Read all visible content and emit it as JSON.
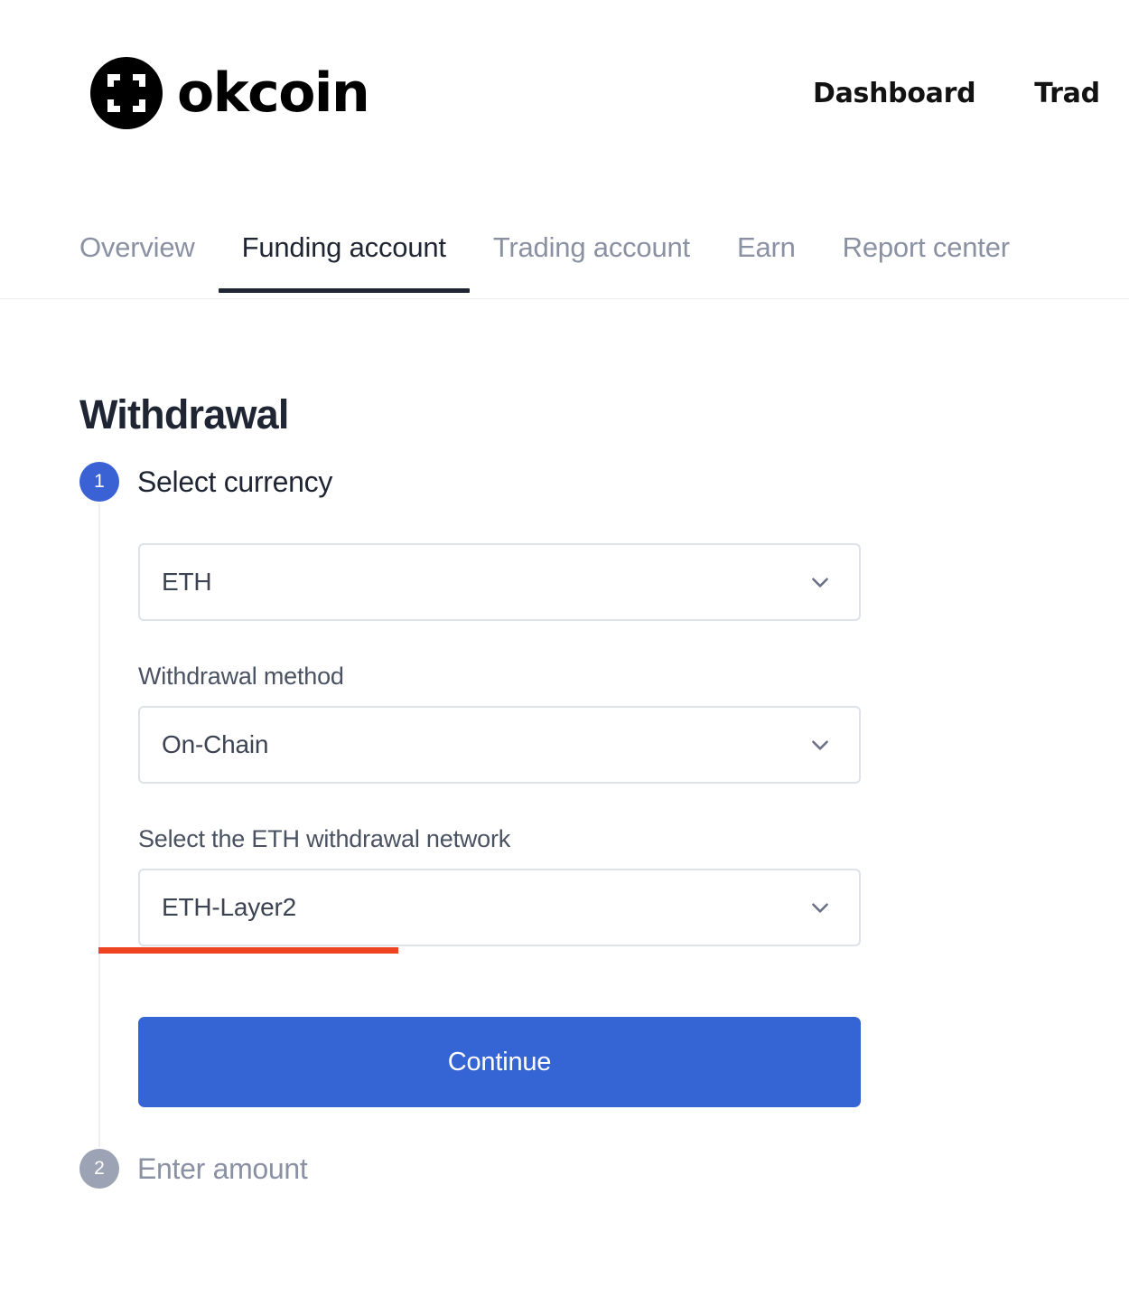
{
  "header": {
    "brand_name": "okcoin",
    "brand_mark_icon": "okcoin-logo-icon",
    "nav": [
      {
        "label": "Dashboard"
      },
      {
        "label": "Trad"
      }
    ]
  },
  "tabs": [
    {
      "label": "Overview",
      "active": false
    },
    {
      "label": "Funding account",
      "active": true
    },
    {
      "label": "Trading account",
      "active": false
    },
    {
      "label": "Earn",
      "active": false
    },
    {
      "label": "Report center",
      "active": false
    }
  ],
  "page": {
    "title": "Withdrawal"
  },
  "steps": [
    {
      "number": "1",
      "title": "Select currency",
      "active": true,
      "fields": {
        "currency": {
          "label": "",
          "value": "ETH",
          "chevron_icon": "chevron-down-icon"
        },
        "method": {
          "label": "Withdrawal method",
          "value": "On-Chain",
          "chevron_icon": "chevron-down-icon"
        },
        "network": {
          "label": "Select the ETH withdrawal network",
          "value": "ETH-Layer2",
          "chevron_icon": "chevron-down-icon"
        }
      },
      "continue_label": "Continue"
    },
    {
      "number": "2",
      "title": "Enter amount",
      "active": false
    }
  ],
  "colors": {
    "accent_blue": "#3565d4",
    "step_active": "#3a62d4",
    "step_inactive": "#9ba3b4",
    "annotation_red": "#ee4422",
    "text_dark": "#1f2532",
    "text_muted": "#8a91a3",
    "border": "#dfe2ea"
  }
}
